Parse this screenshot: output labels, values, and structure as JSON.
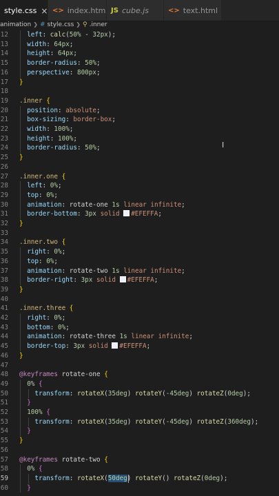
{
  "tabs": [
    {
      "label": "style.css",
      "icon": "css-file-icon",
      "icon_glyph": "#",
      "icon_color": "#519aba",
      "active": true,
      "italic": false,
      "end": "×"
    },
    {
      "label": "index.html",
      "icon": "html-file-icon",
      "icon_glyph": "<>",
      "icon_color": "#e37933",
      "active": false,
      "italic": false,
      "end": ""
    },
    {
      "label": "cube.js",
      "icon": "js-file-icon",
      "icon_glyph": "JS",
      "icon_color": "#cbcb41",
      "active": false,
      "italic": true,
      "end": ""
    },
    {
      "label": "text.html",
      "icon": "html-file-icon",
      "icon_glyph": "<>",
      "icon_color": "#e37933",
      "active": false,
      "italic": false,
      "end": "●"
    }
  ],
  "breadcrumb": {
    "folder": "animation",
    "file_icon": "#",
    "file": "style.css",
    "selector_icon": "⚲",
    "selector": ".inner"
  },
  "current_line": 59,
  "lines": [
    {
      "n": 12,
      "tokens": [
        [
          "  ",
          ""
        ],
        [
          "left",
          "prop"
        ],
        [
          ": ",
          ""
        ],
        [
          "calc",
          "fn"
        ],
        [
          "(",
          "plain"
        ],
        [
          "50%",
          "num"
        ],
        [
          " - ",
          "plain"
        ],
        [
          "32px",
          "num"
        ],
        [
          ")",
          "plain"
        ],
        [
          ";",
          ""
        ]
      ]
    },
    {
      "n": 13,
      "tokens": [
        [
          "  ",
          ""
        ],
        [
          "width",
          "prop"
        ],
        [
          ": ",
          ""
        ],
        [
          "64px",
          "num"
        ],
        [
          ";",
          ""
        ]
      ]
    },
    {
      "n": 14,
      "tokens": [
        [
          "  ",
          ""
        ],
        [
          "height",
          "prop"
        ],
        [
          ": ",
          ""
        ],
        [
          "64px",
          "num"
        ],
        [
          ";",
          ""
        ]
      ]
    },
    {
      "n": 15,
      "tokens": [
        [
          "  ",
          ""
        ],
        [
          "border-radius",
          "prop"
        ],
        [
          ": ",
          ""
        ],
        [
          "50%",
          "num"
        ],
        [
          ";",
          ""
        ]
      ]
    },
    {
      "n": 16,
      "tokens": [
        [
          "  ",
          ""
        ],
        [
          "perspective",
          "prop"
        ],
        [
          ": ",
          ""
        ],
        [
          "800px",
          "num"
        ],
        [
          ";",
          ""
        ]
      ]
    },
    {
      "n": 17,
      "tokens": [
        [
          "}",
          "b1"
        ]
      ]
    },
    {
      "n": 18,
      "tokens": []
    },
    {
      "n": 19,
      "tokens": [
        [
          ".inner",
          "sel"
        ],
        [
          " ",
          ""
        ],
        [
          "{",
          "b1"
        ]
      ]
    },
    {
      "n": 20,
      "tokens": [
        [
          "  ",
          ""
        ],
        [
          "position",
          "prop"
        ],
        [
          ": ",
          ""
        ],
        [
          "absolute",
          "val"
        ],
        [
          ";",
          ""
        ]
      ]
    },
    {
      "n": 21,
      "tokens": [
        [
          "  ",
          ""
        ],
        [
          "box-sizing",
          "prop"
        ],
        [
          ": ",
          ""
        ],
        [
          "border-box",
          "val"
        ],
        [
          ";",
          ""
        ]
      ]
    },
    {
      "n": 22,
      "tokens": [
        [
          "  ",
          ""
        ],
        [
          "width",
          "prop"
        ],
        [
          ": ",
          ""
        ],
        [
          "100%",
          "num"
        ],
        [
          ";",
          ""
        ]
      ]
    },
    {
      "n": 23,
      "tokens": [
        [
          "  ",
          ""
        ],
        [
          "height",
          "prop"
        ],
        [
          ": ",
          ""
        ],
        [
          "100%",
          "num"
        ],
        [
          ";",
          ""
        ]
      ]
    },
    {
      "n": 24,
      "tokens": [
        [
          "  ",
          ""
        ],
        [
          "border-radius",
          "prop"
        ],
        [
          ": ",
          ""
        ],
        [
          "50%",
          "num"
        ],
        [
          ";",
          ""
        ]
      ]
    },
    {
      "n": 25,
      "tokens": [
        [
          "}",
          "b1"
        ]
      ]
    },
    {
      "n": 26,
      "tokens": []
    },
    {
      "n": 27,
      "tokens": [
        [
          ".inner.one",
          "sel"
        ],
        [
          " ",
          ""
        ],
        [
          "{",
          "b1"
        ]
      ]
    },
    {
      "n": 28,
      "tokens": [
        [
          "  ",
          ""
        ],
        [
          "left",
          "prop"
        ],
        [
          ": ",
          ""
        ],
        [
          "0%",
          "num"
        ],
        [
          ";",
          ""
        ]
      ]
    },
    {
      "n": 29,
      "tokens": [
        [
          "  ",
          ""
        ],
        [
          "top",
          "prop"
        ],
        [
          ": ",
          ""
        ],
        [
          "0%",
          "num"
        ],
        [
          ";",
          ""
        ]
      ]
    },
    {
      "n": 30,
      "tokens": [
        [
          "  ",
          ""
        ],
        [
          "animation",
          "prop"
        ],
        [
          ": ",
          ""
        ],
        [
          "rotate-one",
          "plain"
        ],
        [
          " ",
          ""
        ],
        [
          "1s",
          "num"
        ],
        [
          " ",
          ""
        ],
        [
          "linear",
          "val"
        ],
        [
          " ",
          ""
        ],
        [
          "infinite",
          "val"
        ],
        [
          ";",
          ""
        ]
      ]
    },
    {
      "n": 31,
      "tokens": [
        [
          "  ",
          ""
        ],
        [
          "border-bottom",
          "prop"
        ],
        [
          ": ",
          ""
        ],
        [
          "3px",
          "num"
        ],
        [
          " ",
          ""
        ],
        [
          "solid",
          "val"
        ],
        [
          " ",
          ""
        ],
        [
          "SWATCH",
          "swatch"
        ],
        [
          "#EFEFFA",
          "val"
        ],
        [
          ";",
          ""
        ]
      ]
    },
    {
      "n": 32,
      "tokens": [
        [
          "}",
          "b1"
        ]
      ]
    },
    {
      "n": 33,
      "tokens": []
    },
    {
      "n": 34,
      "tokens": [
        [
          ".inner.two",
          "sel"
        ],
        [
          " ",
          ""
        ],
        [
          "{",
          "b1"
        ]
      ]
    },
    {
      "n": 35,
      "tokens": [
        [
          "  ",
          ""
        ],
        [
          "right",
          "prop"
        ],
        [
          ": ",
          ""
        ],
        [
          "0%",
          "num"
        ],
        [
          ";",
          ""
        ]
      ]
    },
    {
      "n": 36,
      "tokens": [
        [
          "  ",
          ""
        ],
        [
          "top",
          "prop"
        ],
        [
          ": ",
          ""
        ],
        [
          "0%",
          "num"
        ],
        [
          ";",
          ""
        ]
      ]
    },
    {
      "n": 37,
      "tokens": [
        [
          "  ",
          ""
        ],
        [
          "animation",
          "prop"
        ],
        [
          ": ",
          ""
        ],
        [
          "rotate-two",
          "plain"
        ],
        [
          " ",
          ""
        ],
        [
          "1s",
          "num"
        ],
        [
          " ",
          ""
        ],
        [
          "linear",
          "val"
        ],
        [
          " ",
          ""
        ],
        [
          "infinite",
          "val"
        ],
        [
          ";",
          ""
        ]
      ]
    },
    {
      "n": 38,
      "tokens": [
        [
          "  ",
          ""
        ],
        [
          "border-right",
          "prop"
        ],
        [
          ": ",
          ""
        ],
        [
          "3px",
          "num"
        ],
        [
          " ",
          ""
        ],
        [
          "solid",
          "val"
        ],
        [
          " ",
          ""
        ],
        [
          "SWATCH",
          "swatch"
        ],
        [
          "#EFEFFA",
          "val"
        ],
        [
          ";",
          ""
        ]
      ]
    },
    {
      "n": 39,
      "tokens": [
        [
          "}",
          "b1"
        ]
      ]
    },
    {
      "n": 40,
      "tokens": []
    },
    {
      "n": 41,
      "tokens": [
        [
          ".inner.three",
          "sel"
        ],
        [
          " ",
          ""
        ],
        [
          "{",
          "b1"
        ]
      ]
    },
    {
      "n": 42,
      "tokens": [
        [
          "  ",
          ""
        ],
        [
          "right",
          "prop"
        ],
        [
          ": ",
          ""
        ],
        [
          "0%",
          "num"
        ],
        [
          ";",
          ""
        ]
      ]
    },
    {
      "n": 43,
      "tokens": [
        [
          "  ",
          ""
        ],
        [
          "bottom",
          "prop"
        ],
        [
          ": ",
          ""
        ],
        [
          "0%",
          "num"
        ],
        [
          ";",
          ""
        ]
      ]
    },
    {
      "n": 44,
      "tokens": [
        [
          "  ",
          ""
        ],
        [
          "animation",
          "prop"
        ],
        [
          ": ",
          ""
        ],
        [
          "rotate-three",
          "plain"
        ],
        [
          " ",
          ""
        ],
        [
          "1s",
          "num"
        ],
        [
          " ",
          ""
        ],
        [
          "linear",
          "val"
        ],
        [
          " ",
          ""
        ],
        [
          "infinite",
          "val"
        ],
        [
          ";",
          ""
        ]
      ]
    },
    {
      "n": 45,
      "tokens": [
        [
          "  ",
          ""
        ],
        [
          "border-top",
          "prop"
        ],
        [
          ": ",
          ""
        ],
        [
          "3px",
          "num"
        ],
        [
          " ",
          ""
        ],
        [
          "solid",
          "val"
        ],
        [
          " ",
          ""
        ],
        [
          "SWATCH",
          "swatch"
        ],
        [
          "#EFEFFA",
          "val"
        ],
        [
          ";",
          ""
        ]
      ]
    },
    {
      "n": 46,
      "tokens": [
        [
          "}",
          "b1"
        ]
      ]
    },
    {
      "n": 47,
      "tokens": []
    },
    {
      "n": 48,
      "tokens": [
        [
          "@keyframes",
          "kw"
        ],
        [
          " ",
          ""
        ],
        [
          "rotate-one",
          "plain"
        ],
        [
          " ",
          ""
        ],
        [
          "{",
          "b1"
        ]
      ]
    },
    {
      "n": 49,
      "tokens": [
        [
          "  ",
          ""
        ],
        [
          "0%",
          "num"
        ],
        [
          " ",
          ""
        ],
        [
          "{",
          "b2"
        ]
      ]
    },
    {
      "n": 50,
      "tokens": [
        [
          "    ",
          ""
        ],
        [
          "transform",
          "prop"
        ],
        [
          ": ",
          ""
        ],
        [
          "rotateX",
          "fn"
        ],
        [
          "(",
          "plain"
        ],
        [
          "35deg",
          "num"
        ],
        [
          ") ",
          "plain"
        ],
        [
          "rotateY",
          "fn"
        ],
        [
          "(",
          "plain"
        ],
        [
          "-45deg",
          "num"
        ],
        [
          ") ",
          "plain"
        ],
        [
          "rotateZ",
          "fn"
        ],
        [
          "(",
          "plain"
        ],
        [
          "0deg",
          "num"
        ],
        [
          ")",
          "plain"
        ],
        [
          ";",
          ""
        ]
      ]
    },
    {
      "n": 51,
      "tokens": [
        [
          "  ",
          ""
        ],
        [
          "}",
          "b2"
        ]
      ]
    },
    {
      "n": 52,
      "tokens": [
        [
          "  ",
          ""
        ],
        [
          "100%",
          "num"
        ],
        [
          " ",
          ""
        ],
        [
          "{",
          "b2"
        ]
      ]
    },
    {
      "n": 53,
      "tokens": [
        [
          "    ",
          ""
        ],
        [
          "transform",
          "prop"
        ],
        [
          ": ",
          ""
        ],
        [
          "rotateX",
          "fn"
        ],
        [
          "(",
          "plain"
        ],
        [
          "35deg",
          "num"
        ],
        [
          ") ",
          "plain"
        ],
        [
          "rotateY",
          "fn"
        ],
        [
          "(",
          "plain"
        ],
        [
          "-45deg",
          "num"
        ],
        [
          ") ",
          "plain"
        ],
        [
          "rotateZ",
          "fn"
        ],
        [
          "(",
          "plain"
        ],
        [
          "360deg",
          "num"
        ],
        [
          ")",
          "plain"
        ],
        [
          ";",
          ""
        ]
      ]
    },
    {
      "n": 54,
      "tokens": [
        [
          "  ",
          ""
        ],
        [
          "}",
          "b2"
        ]
      ]
    },
    {
      "n": 55,
      "tokens": [
        [
          "}",
          "b1"
        ]
      ]
    },
    {
      "n": 56,
      "tokens": []
    },
    {
      "n": 57,
      "tokens": [
        [
          "@keyframes",
          "kw"
        ],
        [
          " ",
          ""
        ],
        [
          "rotate-two",
          "plain"
        ],
        [
          " ",
          ""
        ],
        [
          "{",
          "b1"
        ]
      ]
    },
    {
      "n": 58,
      "tokens": [
        [
          "  ",
          ""
        ],
        [
          "0%",
          "num"
        ],
        [
          " ",
          ""
        ],
        [
          "{",
          "b2"
        ]
      ]
    },
    {
      "n": 59,
      "tokens": [
        [
          "    ",
          ""
        ],
        [
          "transform",
          "prop"
        ],
        [
          ": ",
          ""
        ],
        [
          "rotateX",
          "fn"
        ],
        [
          "(",
          "plain"
        ],
        [
          "50deg",
          "hl"
        ],
        [
          ") ",
          "plain"
        ],
        [
          "rotateY",
          "fn"
        ],
        [
          "() ",
          "plain"
        ],
        [
          "rotateZ",
          "fn"
        ],
        [
          "(",
          "plain"
        ],
        [
          "0deg",
          "num"
        ],
        [
          ")",
          "plain"
        ],
        [
          ";",
          ""
        ]
      ]
    },
    {
      "n": 60,
      "tokens": [
        [
          "  ",
          ""
        ],
        [
          "}",
          "b2"
        ]
      ]
    }
  ]
}
